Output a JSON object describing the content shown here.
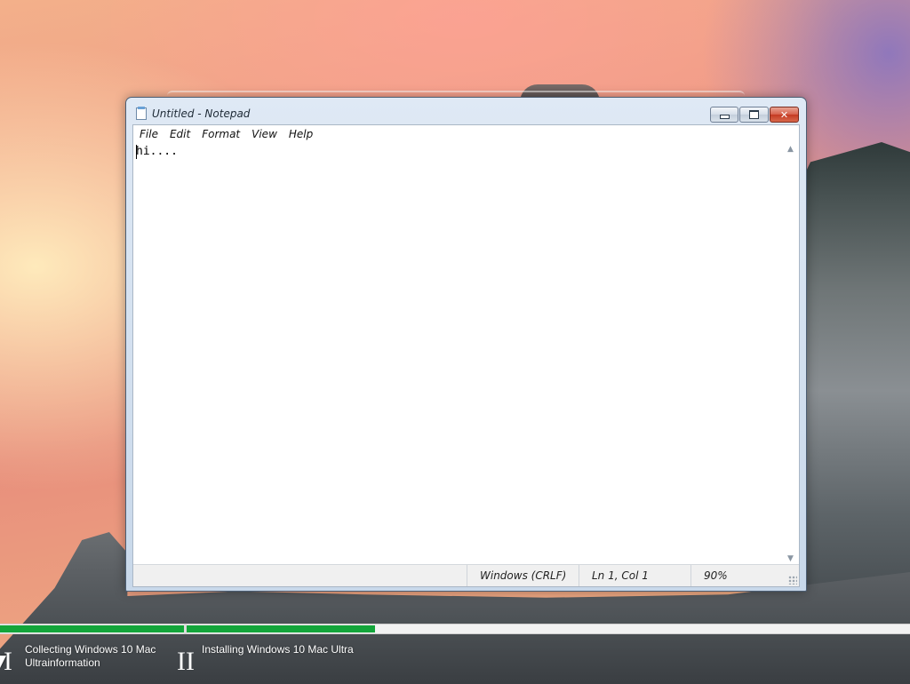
{
  "window": {
    "title": "Untitled - Notepad",
    "controls": {
      "minimize": "minimize",
      "maximize": "maximize",
      "close": "✕"
    }
  },
  "menu": [
    "File",
    "Edit",
    "Format",
    "View",
    "Help"
  ],
  "editor": {
    "content": "hi...."
  },
  "status": {
    "line_ending": "Windows (CRLF)",
    "position": "Ln 1, Col 1",
    "zoom": "90%"
  },
  "installer": {
    "step1": {
      "number": "I",
      "label": "Collecting Windows 10 Mac Ultrainformation"
    },
    "step2": {
      "number": "II",
      "label": "Installing Windows 10 Mac Ultra"
    },
    "progress_step1": 1.0,
    "progress_step2": 0.26,
    "bar_color": "#13a53a"
  }
}
